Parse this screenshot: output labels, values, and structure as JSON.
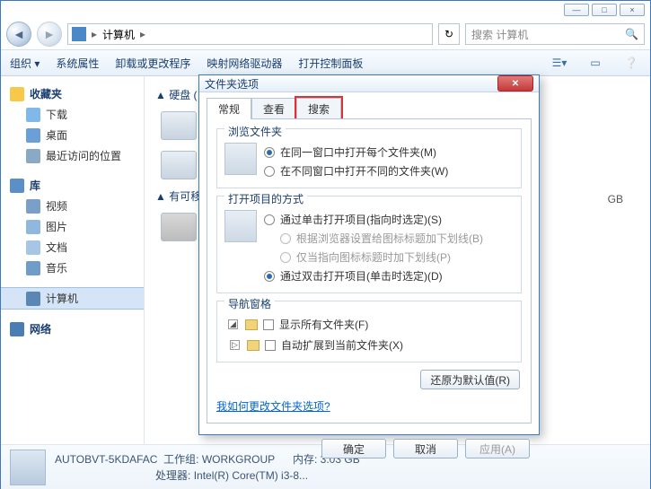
{
  "window": {
    "min": "—",
    "max": "□",
    "close": "×"
  },
  "addr": {
    "location": "计算机",
    "sep": "▸",
    "refresh": "↻",
    "search_placeholder": "搜索 计算机",
    "search_icon": "🔍"
  },
  "toolbar": {
    "organize": "组织 ▾",
    "props": "系统属性",
    "uninstall": "卸载或更改程序",
    "map_drive": "映射网络驱动器",
    "control_panel": "打开控制面板"
  },
  "sidebar": {
    "fav": "收藏夹",
    "downloads": "下载",
    "desktop": "桌面",
    "recent": "最近访问的位置",
    "lib": "库",
    "videos": "视频",
    "pictures": "图片",
    "documents": "文档",
    "music": "音乐",
    "computer": "计算机",
    "network": "网络"
  },
  "content": {
    "hard_drives": "▲ 硬盘 (",
    "removable": "▲ 有可移",
    "gb": "GB"
  },
  "details": {
    "name": "AUTOBVT-5KDAFAC",
    "wg_label": "工作组:",
    "wg": "WORKGROUP",
    "mem_label": "内存:",
    "mem": "3.03 GB",
    "cpu_label": "处理器:",
    "cpu": "Intel(R) Core(TM) i3-8..."
  },
  "dialog": {
    "title": "文件夹选项",
    "tabs": {
      "general": "常规",
      "view": "查看",
      "search": "搜索"
    },
    "browse": {
      "legend": "浏览文件夹",
      "same": "在同一窗口中打开每个文件夹(M)",
      "new": "在不同窗口中打开不同的文件夹(W)"
    },
    "click": {
      "legend": "打开项目的方式",
      "single": "通过单击打开项目(指向时选定)(S)",
      "underline_browser": "根据浏览器设置给图标标题加下划线(B)",
      "underline_hover": "仅当指向图标标题时加下划线(P)",
      "double": "通过双击打开项目(单击时选定)(D)"
    },
    "nav": {
      "legend": "导航窗格",
      "show_all": "显示所有文件夹(F)",
      "auto_expand": "自动扩展到当前文件夹(X)"
    },
    "restore": "还原为默认值(R)",
    "link": "我如何更改文件夹选项?",
    "ok": "确定",
    "cancel": "取消",
    "apply": "应用(A)"
  }
}
